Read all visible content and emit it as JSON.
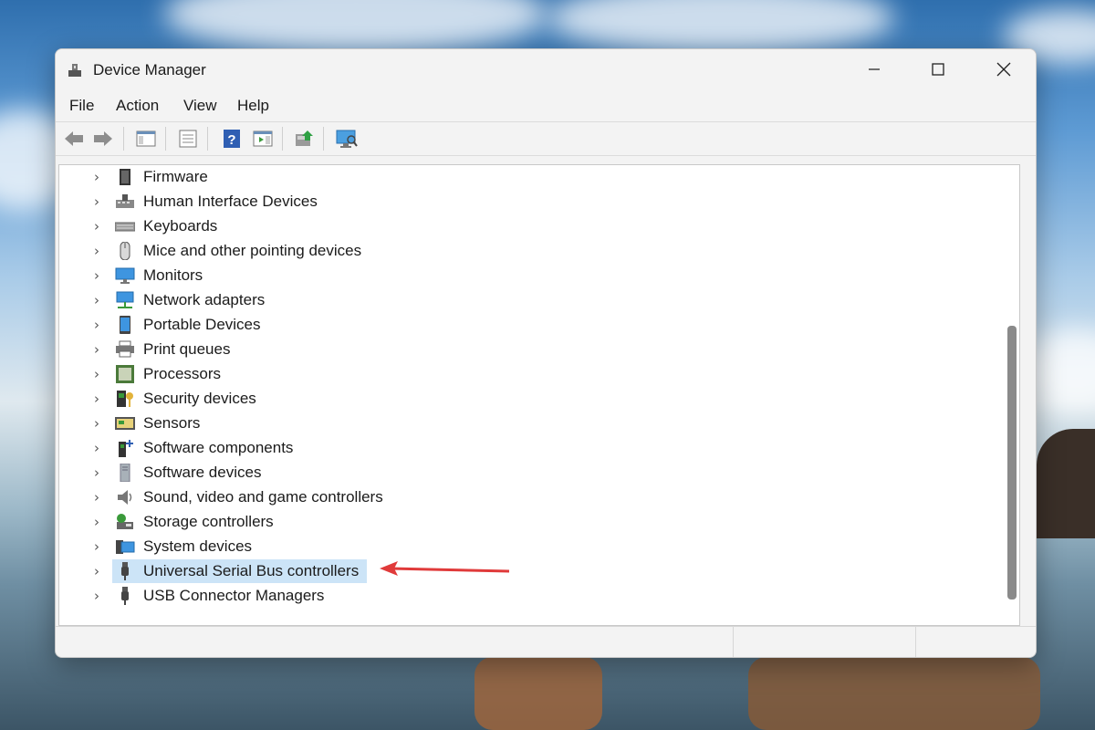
{
  "window": {
    "title": "Device Manager",
    "controls": {
      "minimize": "—",
      "maximize": "☐",
      "close": "✕"
    }
  },
  "menu": [
    "File",
    "Action",
    "View",
    "Help"
  ],
  "toolbar_icons": [
    "back-icon",
    "forward-icon",
    "show-hide-console-tree-icon",
    "properties-icon",
    "help-icon",
    "action-pane-icon",
    "update-driver-icon",
    "scan-hardware-icon"
  ],
  "tree": [
    {
      "label": "Firmware",
      "icon": "firmware-icon"
    },
    {
      "label": "Human Interface Devices",
      "icon": "hid-icon"
    },
    {
      "label": "Keyboards",
      "icon": "keyboard-icon"
    },
    {
      "label": "Mice and other pointing devices",
      "icon": "mouse-icon"
    },
    {
      "label": "Monitors",
      "icon": "monitor-icon"
    },
    {
      "label": "Network adapters",
      "icon": "network-icon"
    },
    {
      "label": "Portable Devices",
      "icon": "portable-icon"
    },
    {
      "label": "Print queues",
      "icon": "printer-icon"
    },
    {
      "label": "Processors",
      "icon": "processor-icon"
    },
    {
      "label": "Security devices",
      "icon": "security-icon"
    },
    {
      "label": "Sensors",
      "icon": "sensor-icon"
    },
    {
      "label": "Software components",
      "icon": "software-components-icon"
    },
    {
      "label": "Software devices",
      "icon": "software-devices-icon"
    },
    {
      "label": "Sound, video and game controllers",
      "icon": "sound-icon"
    },
    {
      "label": "Storage controllers",
      "icon": "storage-icon"
    },
    {
      "label": "System devices",
      "icon": "system-icon"
    },
    {
      "label": "Universal Serial Bus controllers",
      "icon": "usb-icon",
      "selected": true
    },
    {
      "label": "USB Connector Managers",
      "icon": "usb-connector-icon"
    }
  ],
  "colors": {
    "selection": "#cce4f7",
    "annotation_arrow": "#e03a3a"
  }
}
